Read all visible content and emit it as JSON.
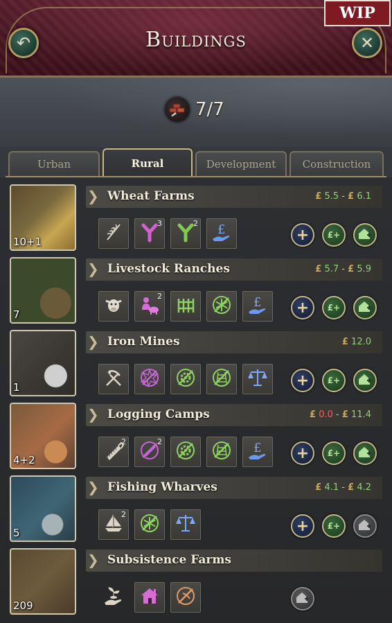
{
  "header": {
    "title": "Buildings",
    "wip_label": "WIP",
    "back_glyph": "↶",
    "close_glyph": "✕"
  },
  "slots": {
    "value": "7/7",
    "icon": "bricks-icon"
  },
  "tabs": [
    {
      "label": "Urban",
      "active": false
    },
    {
      "label": "Rural",
      "active": true
    },
    {
      "label": "Development",
      "active": false
    },
    {
      "label": "Construction",
      "active": false
    }
  ],
  "buildings": [
    {
      "name": "Wheat Farms",
      "count": "10+1",
      "income": {
        "low": "5.5",
        "high": "6.1",
        "currency": "£",
        "sep": "-"
      },
      "tiles": [
        {
          "icon": "wheat-icon",
          "badge": ""
        },
        {
          "icon": "production-method-icon",
          "badge": "3"
        },
        {
          "icon": "production-method-green-icon",
          "badge": "2"
        },
        {
          "icon": "ownership-pound-hand-icon",
          "badge": ""
        }
      ],
      "add_enabled": true,
      "money_enabled": true,
      "home_enabled": true
    },
    {
      "name": "Livestock Ranches",
      "count": "7",
      "income": {
        "low": "5.7",
        "high": "5.9",
        "currency": "£",
        "sep": "-"
      },
      "tiles": [
        {
          "icon": "cattle-icon",
          "badge": ""
        },
        {
          "icon": "worker-pig-icon",
          "badge": "2"
        },
        {
          "icon": "fence-icon",
          "badge": ""
        },
        {
          "icon": "refrigeration-icon",
          "badge": ""
        },
        {
          "icon": "ownership-pound-hand-icon",
          "badge": ""
        }
      ],
      "add_enabled": true,
      "money_enabled": true,
      "home_enabled": true
    },
    {
      "name": "Iron Mines",
      "count": "1",
      "income": {
        "single": "12.0",
        "currency": "£"
      },
      "tiles": [
        {
          "icon": "pickaxe-shovel-icon",
          "badge": ""
        },
        {
          "icon": "explosives-icon",
          "badge": ""
        },
        {
          "icon": "steam-gear-icon",
          "badge": ""
        },
        {
          "icon": "rail-transport-icon",
          "badge": ""
        },
        {
          "icon": "scales-icon",
          "badge": ""
        }
      ],
      "add_enabled": true,
      "money_enabled": true,
      "home_enabled": true
    },
    {
      "name": "Logging Camps",
      "count": "4+2",
      "income": {
        "low": "0.0",
        "high": "11.4",
        "currency": "£",
        "sep": "-",
        "low_negative": true
      },
      "tiles": [
        {
          "icon": "saw-icon",
          "badge": "2"
        },
        {
          "icon": "chainsaw-icon",
          "badge": "2"
        },
        {
          "icon": "steam-gear-icon",
          "badge": ""
        },
        {
          "icon": "rail-transport-icon",
          "badge": ""
        },
        {
          "icon": "ownership-pound-hand-icon",
          "badge": ""
        }
      ],
      "add_enabled": true,
      "money_enabled": true,
      "home_enabled": true
    },
    {
      "name": "Fishing Wharves",
      "count": "5",
      "income": {
        "low": "4.1",
        "high": "4.2",
        "currency": "£",
        "sep": "-"
      },
      "tiles": [
        {
          "icon": "sailboat-icon",
          "badge": "2"
        },
        {
          "icon": "refrigeration-icon",
          "badge": ""
        },
        {
          "icon": "scales-icon",
          "badge": ""
        }
      ],
      "add_enabled": true,
      "money_enabled": true,
      "home_enabled": false
    },
    {
      "name": "Subsistence Farms",
      "count": "209",
      "income": null,
      "tiles": [
        {
          "icon": "seedling-hand-icon",
          "badge": "",
          "plain": true
        },
        {
          "icon": "cottage-icon",
          "badge": ""
        },
        {
          "icon": "cottage-crafts-icon",
          "badge": ""
        }
      ],
      "add_enabled": false,
      "money_enabled": false,
      "home_enabled": false
    }
  ],
  "colors": {
    "header_bg": "#3b1019",
    "frame_gold": "#b59a5f",
    "income_green": "#8fd27a",
    "income_red": "#ff5c5c",
    "wip_bg": "#7d1a22"
  }
}
